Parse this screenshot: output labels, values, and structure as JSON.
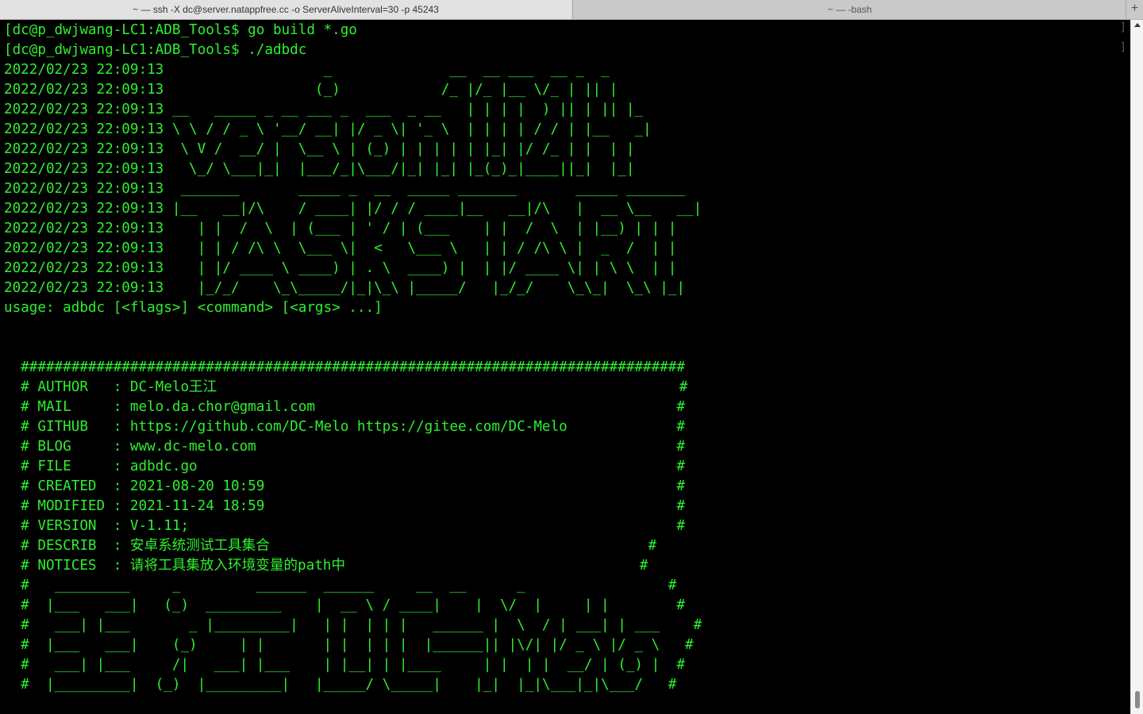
{
  "tabs": [
    {
      "label": "~ — ssh -X dc@server.natappfree.cc -o ServerAliveInterval=30 -p 45243"
    },
    {
      "label": "~ — -bash"
    }
  ],
  "new_tab_label": "+",
  "terminal": {
    "lines": [
      "[dc@p_dwjwang-LC1:ADB_Tools$ go build *.go",
      "[dc@p_dwjwang-LC1:ADB_Tools$ ./adbdc",
      "2022/02/23 22:09:13                   _              __  __ ___  __ _  _",
      "2022/02/23 22:09:13                  (_)            /_ |/_ |__ \\/_ | || |",
      "2022/02/23 22:09:13 __   _____ _ __ ___ _  ___  _ __   | | | |  ) || | || |_",
      "2022/02/23 22:09:13 \\ \\ / / _ \\ '__/ __| |/ _ \\| '_ \\  | | | | / / | |__   _|",
      "2022/02/23 22:09:13  \\ V /  __/ |  \\__ \\ | (_) | | | | | |_| |/ /_ | |  | |",
      "2022/02/23 22:09:13   \\_/ \\___|_|  |___/_|\\___/|_| |_| |_(_)_|____||_|  |_|",
      "2022/02/23 22:09:13  _______       _____ _  __  _____ _______       _____ _______",
      "2022/02/23 22:09:13 |__   __|/\\    / ____| |/ / / ____|__   __|/\\   |  __ \\__   __|",
      "2022/02/23 22:09:13    | |  /  \\  | (___ | ' / | (___    | |  /  \\  | |__) | | |",
      "2022/02/23 22:09:13    | | / /\\ \\  \\___ \\|  <   \\___ \\   | | / /\\ \\ |  _  /  | |",
      "2022/02/23 22:09:13    | |/ ____ \\ ____) | . \\  ____) |  | |/ ____ \\| | \\ \\  | |",
      "2022/02/23 22:09:13    |_/_/    \\_\\_____/|_|\\_\\ |_____/   |_/_/    \\_\\_|  \\_\\ |_|",
      "usage: adbdc [<flags>] <command> [<args> ...]",
      "",
      "",
      "  ###############################################################################",
      "  # AUTHOR   : DC-Melo王江                                                       #",
      "  # MAIL     : melo.da.chor@gmail.com                                           #",
      "  # GITHUB   : https://github.com/DC-Melo https://gitee.com/DC-Melo             #",
      "  # BLOG     : www.dc-melo.com                                                  #",
      "  # FILE     : adbdc.go                                                         #",
      "  # CREATED  : 2021-08-20 10:59                                                 #",
      "  # MODIFIED : 2021-11-24 18:59                                                 #",
      "  # VERSION  : V-1.11;                                                          #",
      "  # DESCRIB  : 安卓系统测试工具集合                                             #",
      "  # NOTICES  : 请将工具集放入环境变量的path中                                   #",
      "  #   _________     _         ______  ______     __  __      _                 #",
      "  #  |___   ___|   (_)  _________    |  __ \\ / ____|    |  \\/  |     | |        #",
      "  #   ___| |___       _ |_________|   | |  | | |   ______ |  \\  / | ___| | ___    #",
      "  #  |___   ___|    (_)     | |       | |  | | |  |______|| |\\/| |/ _ \\ |/ _ \\   #",
      "  #   ___| |___     /|   ___| |___    | |__| | |____     | |  | |  __/ | (_) |  #",
      "  #  |_________|  (_)  |_________|   |_____/ \\_____|    |_|  |_|\\___|_|\\___/   #"
    ]
  }
}
